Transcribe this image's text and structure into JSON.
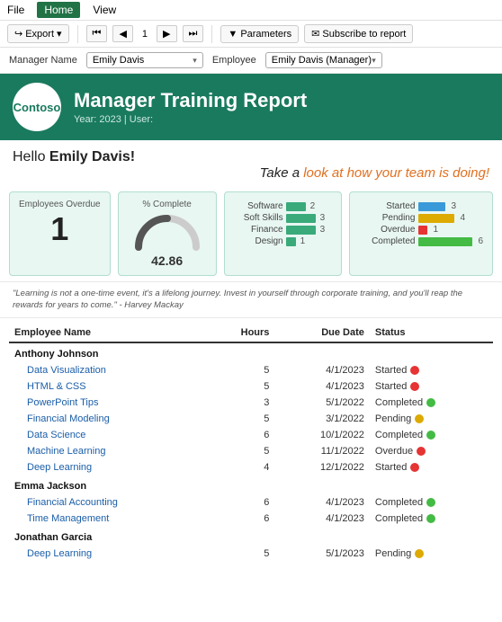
{
  "menubar": {
    "items": [
      "File",
      "Home",
      "View"
    ],
    "active": "Home"
  },
  "toolbar": {
    "export_label": "Export",
    "nav_prev_prev": "⏮",
    "nav_prev": "◀",
    "page_num": "1",
    "nav_next": "▶",
    "nav_next_next": "⏭",
    "parameters_label": "Parameters",
    "subscribe_label": "Subscribe to report"
  },
  "filters": {
    "manager_label": "Manager Name",
    "manager_value": "Emily Davis",
    "employee_label": "Employee",
    "employee_value": "Emily Davis (Manager)"
  },
  "banner": {
    "logo": "Contoso",
    "title": "Manager Training Report",
    "subtitle": "Year: 2023 | User:"
  },
  "hello": {
    "greeting": "Hello ",
    "name": "Emily Davis!",
    "tagline_black": "Take a ",
    "tagline_orange": "look at how your team is doing!"
  },
  "stats": {
    "overdue_title": "Employees Overdue",
    "overdue_value": "1",
    "complete_title": "% Complete",
    "complete_value": "42.86",
    "categories": [
      {
        "label": "Software",
        "value": 2,
        "max": 6
      },
      {
        "label": "Soft Skills",
        "value": 3,
        "max": 6
      },
      {
        "label": "Finance",
        "value": 3,
        "max": 6
      },
      {
        "label": "Design",
        "value": 1,
        "max": 6
      }
    ],
    "statuses": [
      {
        "label": "Started",
        "value": 3,
        "color": "#3a9ad9",
        "max": 6
      },
      {
        "label": "Pending",
        "value": 4,
        "color": "#ddaa00",
        "max": 6
      },
      {
        "label": "Overdue",
        "value": 1,
        "color": "#e63333",
        "max": 6
      },
      {
        "label": "Completed",
        "value": 6,
        "color": "#44bb44",
        "max": 6
      }
    ]
  },
  "quote": "\"Learning is not a one-time event, it's a lifelong journey. Invest in yourself through corporate training, and you'll reap the rewards for years to come.\" - Harvey Mackay",
  "table": {
    "headers": [
      "Employee Name",
      "Hours",
      "Due Date",
      "Status"
    ],
    "rows": [
      {
        "type": "employee",
        "name": "Anthony Johnson"
      },
      {
        "type": "course",
        "name": "Data Visualization",
        "hours": 5,
        "due": "4/1/2023",
        "status": "Started",
        "dot": "red"
      },
      {
        "type": "course",
        "name": "HTML & CSS",
        "hours": 5,
        "due": "4/1/2023",
        "status": "Started",
        "dot": "red"
      },
      {
        "type": "course",
        "name": "PowerPoint Tips",
        "hours": 3,
        "due": "5/1/2022",
        "status": "Completed",
        "dot": "green"
      },
      {
        "type": "course",
        "name": "Financial Modeling",
        "hours": 5,
        "due": "3/1/2022",
        "status": "Pending",
        "dot": "yellow"
      },
      {
        "type": "course",
        "name": "Data Science",
        "hours": 6,
        "due": "10/1/2022",
        "status": "Completed",
        "dot": "green"
      },
      {
        "type": "course",
        "name": "Machine Learning",
        "hours": 5,
        "due": "11/1/2022",
        "status": "Overdue",
        "dot": "red"
      },
      {
        "type": "course",
        "name": "Deep Learning",
        "hours": 4,
        "due": "12/1/2022",
        "status": "Started",
        "dot": "red"
      },
      {
        "type": "employee",
        "name": "Emma Jackson"
      },
      {
        "type": "course",
        "name": "Financial Accounting",
        "hours": 6,
        "due": "4/1/2023",
        "status": "Completed",
        "dot": "green"
      },
      {
        "type": "course",
        "name": "Time Management",
        "hours": 6,
        "due": "4/1/2023",
        "status": "Completed",
        "dot": "green"
      },
      {
        "type": "employee",
        "name": "Jonathan Garcia"
      },
      {
        "type": "course",
        "name": "Deep Learning",
        "hours": 5,
        "due": "5/1/2023",
        "status": "Pending",
        "dot": "yellow"
      }
    ]
  }
}
